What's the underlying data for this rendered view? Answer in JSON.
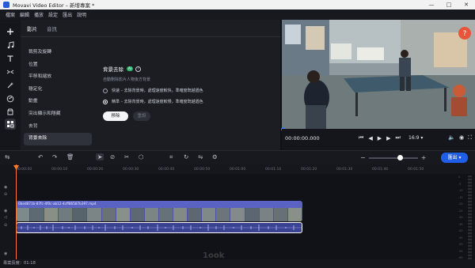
{
  "window": {
    "title": "Movavi Video Editor – 新增專案 *",
    "controls": [
      "—",
      "□",
      "✕"
    ]
  },
  "menu": [
    "檔案",
    "編輯",
    "播放",
    "設定",
    "匯出",
    "說明"
  ],
  "left_tools": [
    "plus-icon",
    "music-icon",
    "text-icon",
    "transition-icon",
    "magic-icon",
    "sticker-icon",
    "clock-icon",
    "tools-icon"
  ],
  "panel": {
    "tabs": [
      "影片",
      "音訊"
    ],
    "filters": [
      "裁剪及旋轉",
      "位置",
      "平移和縮放",
      "穩定化",
      "動畫",
      "突出顯示和隱藏",
      "去背",
      "背景去除"
    ],
    "section_title": "背景去除",
    "badge": "AI",
    "description": "自動刪除影片人物後方背景",
    "options": [
      "快速 – 去除背景時，處理速度較快，準確度既越遜色",
      "精準 – 去除背景時，處理速度較慢，準確度既越遜色"
    ],
    "selected_option_index": 1,
    "apply_label": "移除",
    "reset_label": "重設"
  },
  "player": {
    "timecode": "00:00:00.000",
    "ratio": "16:9",
    "ratio_arrow": "▾"
  },
  "timeline": {
    "ruler_ticks": [
      "00:00:00",
      "00:00:10",
      "00:00:20",
      "00:00:30",
      "00:00:40",
      "00:00:50",
      "00:01:00",
      "00:01:10",
      "00:01:20",
      "00:01:30",
      "00:01:40",
      "00:01:50"
    ],
    "clip_name": "0bed871b-87fc-4f0c-ab12-4cff86587b397.mp4",
    "vu_labels": [
      "0",
      "-5",
      "-10",
      "-15",
      "-20",
      "-25",
      "-30",
      "-35",
      "-40",
      "-45",
      "-50",
      "-55",
      "-60"
    ],
    "export_label": "匯出",
    "export_arrow": "▾"
  },
  "status": "專案長度：01:18",
  "watermark": "1ook"
}
